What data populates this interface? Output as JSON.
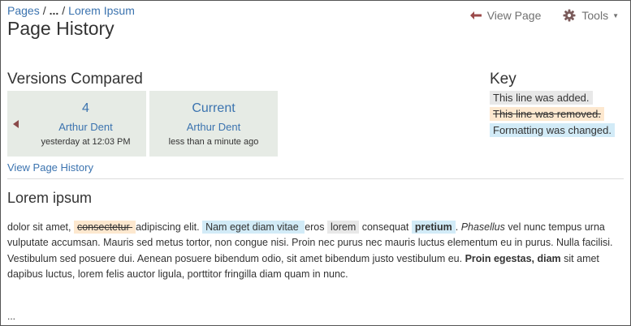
{
  "breadcrumb": {
    "pages": "Pages",
    "ellipsis": "...",
    "current": "Lorem Ipsum"
  },
  "page_title": "Page History",
  "toolbar": {
    "view_page": "View Page",
    "tools": "Tools"
  },
  "versions": {
    "heading": "Versions Compared",
    "old": {
      "number": "4",
      "author": "Arthur Dent",
      "time": "yesterday at 12:03 PM"
    },
    "new": {
      "number": "Current",
      "author": "Arthur Dent",
      "time": "less than a minute ago"
    },
    "view_history_link": "View Page History"
  },
  "key": {
    "heading": "Key",
    "added": "This line was added.",
    "removed": "This line was removed.",
    "formatted": "Formatting was changed."
  },
  "content": {
    "title": "Lorem ipsum",
    "p1": "dolor sit amet, ",
    "removed1": "consectetur ",
    "p2": " adipiscing elit. ",
    "format1": "Nam eget diam vitae ",
    "p3": " eros ",
    "added1": "lorem",
    "p4": " consequat ",
    "format2": "pretium",
    "p5": ". ",
    "italic1": "Phasellus",
    "p6": " vel nunc tempus urna vulputate accumsan. Mauris sed metus tortor, non congue nisi. Proin nec purus nec mauris luctus elementum eu in purus. Nulla facilisi. Vestibulum sed posuere dui. Aenean posuere bibendum odio, sit amet bibendum justo vestibulum eu. ",
    "bold1": "Proin egestas, diam",
    "p7": " sit amet dapibus luctus, lorem felis auctor ligula, porttitor fringilla diam quam in nunc.",
    "more": "..."
  },
  "colors": {
    "link": "#3b73af",
    "added_bg": "#e8e8e8",
    "removed_bg": "#fde8cf",
    "formatted_bg": "#d2ebf7",
    "version_card_bg": "#e6ebe5"
  }
}
